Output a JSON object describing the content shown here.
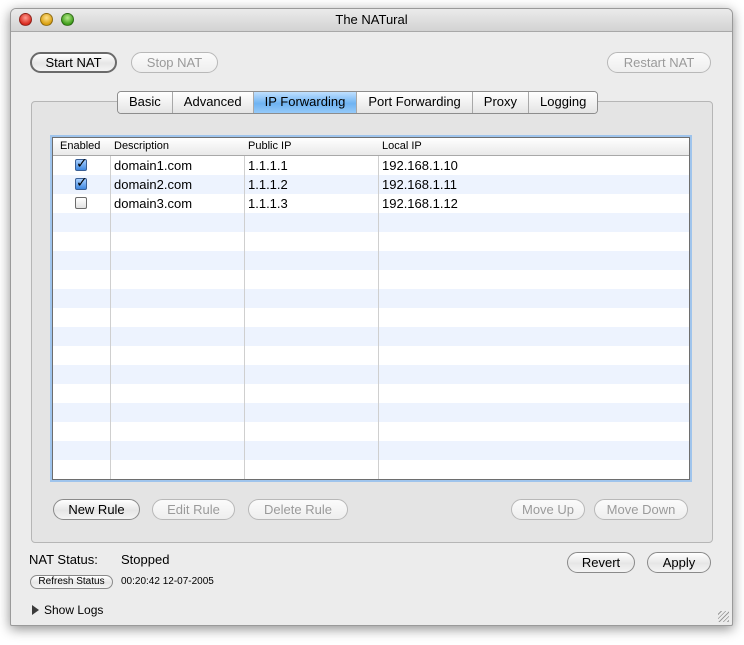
{
  "window": {
    "title": "The NATural"
  },
  "toolbar": {
    "start_label": "Start NAT",
    "stop_label": "Stop NAT",
    "restart_label": "Restart NAT"
  },
  "tabs": [
    {
      "label": "Basic",
      "selected": false
    },
    {
      "label": "Advanced",
      "selected": false
    },
    {
      "label": "IP Forwarding",
      "selected": true
    },
    {
      "label": "Port Forwarding",
      "selected": false
    },
    {
      "label": "Proxy",
      "selected": false
    },
    {
      "label": "Logging",
      "selected": false
    }
  ],
  "table": {
    "headers": {
      "enabled": "Enabled",
      "description": "Description",
      "public_ip": "Public IP",
      "local_ip": "Local IP"
    },
    "rows": [
      {
        "enabled": true,
        "description": "domain1.com",
        "public_ip": "1.1.1.1",
        "local_ip": "192.168.1.10"
      },
      {
        "enabled": true,
        "description": "domain2.com",
        "public_ip": "1.1.1.2",
        "local_ip": "192.168.1.11"
      },
      {
        "enabled": false,
        "description": "domain3.com",
        "public_ip": "1.1.1.3",
        "local_ip": "192.168.1.12"
      }
    ]
  },
  "rule_buttons": {
    "new_label": "New Rule",
    "edit_label": "Edit Rule",
    "delete_label": "Delete Rule",
    "up_label": "Move Up",
    "down_label": "Move Down"
  },
  "status": {
    "label": "NAT Status:",
    "value": "Stopped",
    "refresh_label": "Refresh Status",
    "timestamp": "00:20:42 12-07-2005"
  },
  "footer": {
    "revert_label": "Revert",
    "apply_label": "Apply",
    "show_logs_label": "Show Logs"
  },
  "colors": {
    "selected_tab": "#6fb3f2",
    "alt_row": "#edf3fe",
    "focus_ring": "#9fc4ec"
  }
}
